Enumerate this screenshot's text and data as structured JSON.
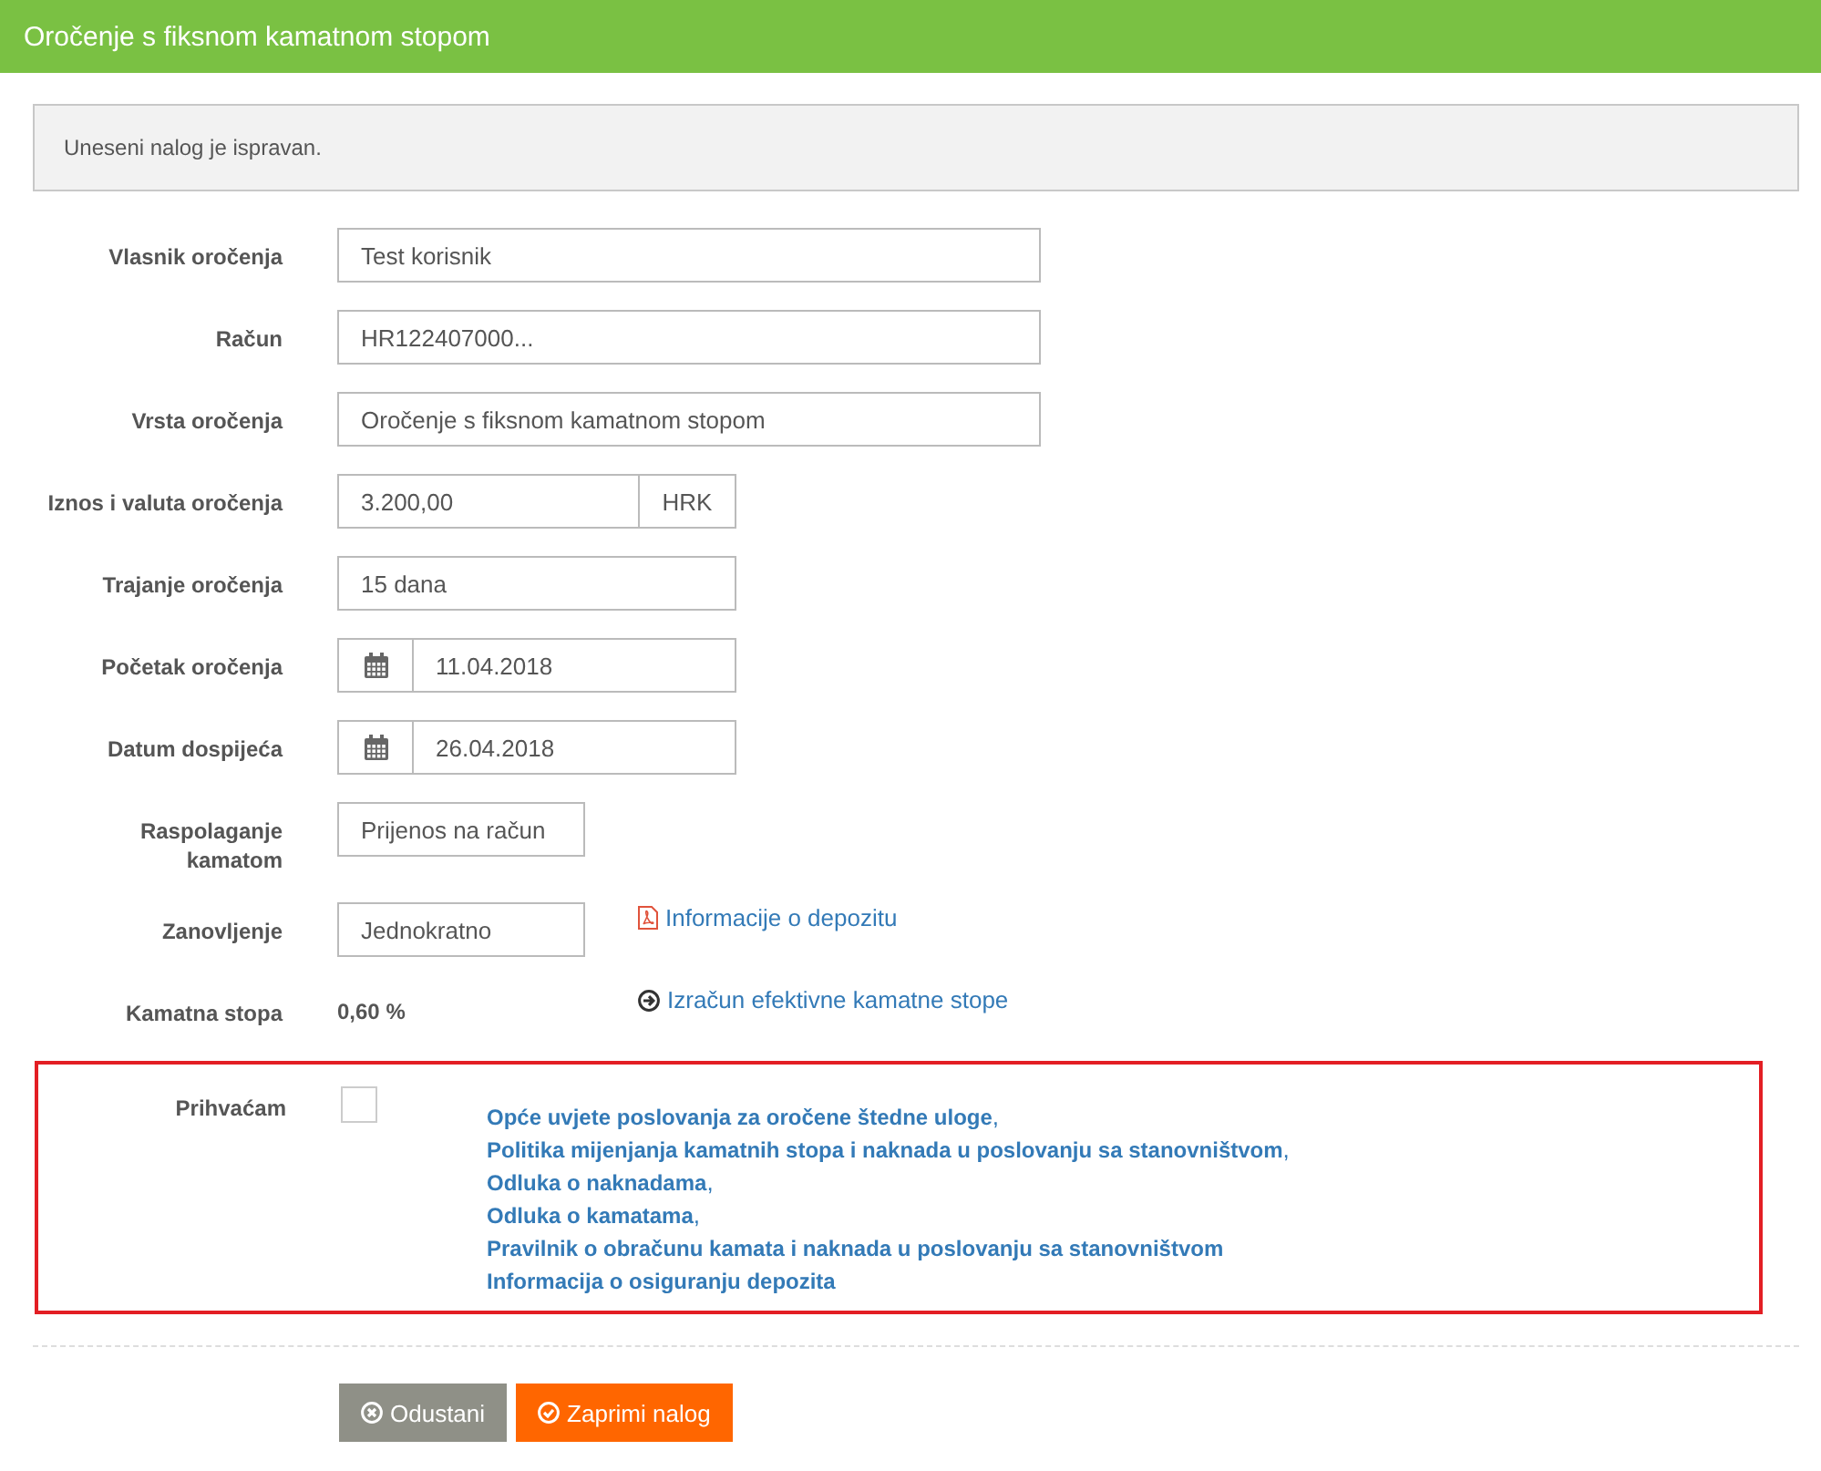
{
  "header": {
    "title": "Oročenje s fiksnom kamatnom stopom"
  },
  "alert": {
    "text": "Uneseni nalog je ispravan."
  },
  "rows": [
    {
      "label": "Vlasnik oročenja",
      "kind": "wide",
      "value": "Test korisnik"
    },
    {
      "label": "Račun",
      "kind": "wide",
      "value": "HR122407000..."
    },
    {
      "label": "Vrsta oročenja",
      "kind": "wide",
      "value": "Oročenje s fiksnom kamatnom stopom"
    },
    {
      "label": "Iznos i valuta oročenja",
      "kind": "amount",
      "value": "3.200,00",
      "addon": "HRK"
    },
    {
      "label": "Trajanje oročenja",
      "kind": "medium",
      "value": "15 dana"
    },
    {
      "label": "Početak oročenja",
      "kind": "date",
      "value": "11.04.2018"
    },
    {
      "label": "Datum dospijeća",
      "kind": "date",
      "value": "26.04.2018"
    },
    {
      "label": "Raspolaganje kamatom",
      "kind": "short",
      "value": "Prijenos na račun"
    },
    {
      "label": "Zanovljenje",
      "kind": "short",
      "value": "Jednokratno",
      "link": {
        "text": "Informacije o depozitu",
        "kind": "pdf"
      }
    },
    {
      "label": "Kamatna stopa",
      "kind": "value",
      "value": "0,60 %",
      "link": {
        "text": "Izračun efektivne kamatne stope",
        "kind": "calculate"
      }
    }
  ],
  "acceptance": {
    "label": "Prihvaćam",
    "checked": false,
    "documents": [
      {
        "text": "Opće uvjete poslovanja za oročene štedne uloge",
        "separator": ","
      },
      {
        "text": "Politika mijenjanja kamatnih stopa i naknada u poslovanju sa stanovništvom",
        "separator": ","
      },
      {
        "text": "Odluka o naknadama",
        "separator": ","
      },
      {
        "text": "Odluka o kamatama",
        "separator": ","
      },
      {
        "text": "Pravilnik o obračunu kamata i naknada u poslovanju sa stanovništvom"
      },
      {
        "text": "Informacija o osiguranju depozita"
      }
    ]
  },
  "buttons": [
    {
      "label": "Odustani",
      "kind": "cancel"
    },
    {
      "label": "Zaprimi nalog",
      "kind": "submit"
    }
  ]
}
